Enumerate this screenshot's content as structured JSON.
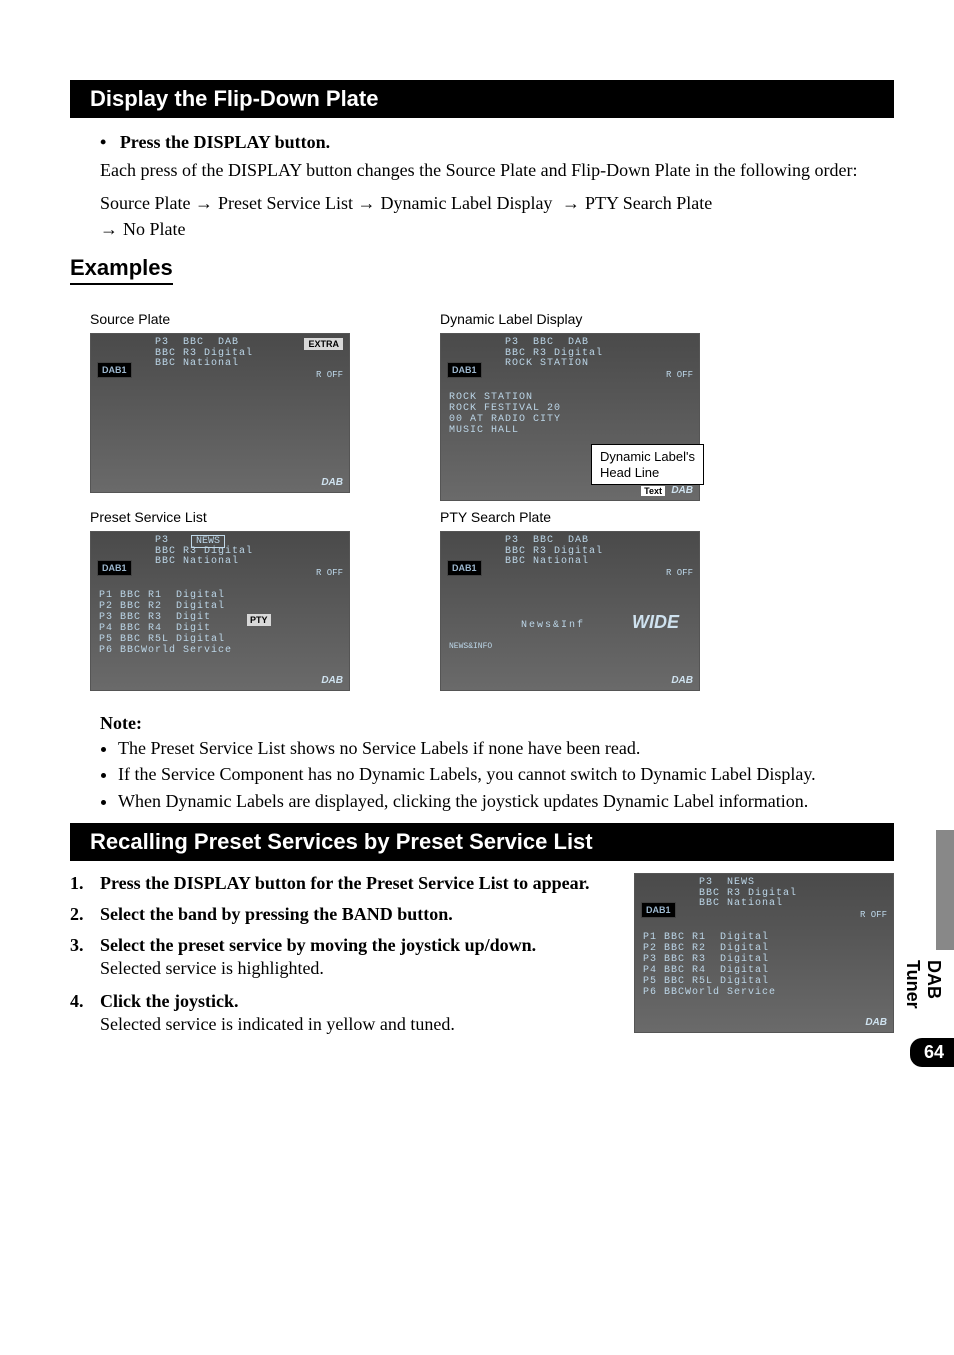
{
  "side_tab": "DAB Tuner",
  "page_number": "64",
  "sec1": {
    "title": "Display the Flip-Down Plate",
    "bullet_title": "Press the DISPLAY button.",
    "bullet_body": "Each press of the DISPLAY button changes the Source Plate and Flip-Down Plate in the following order:",
    "flow": {
      "a": "Source Plate",
      "b": "Preset Service List",
      "c": "Dynamic Label Display",
      "d": "PTY Search Plate",
      "e": "No Plate"
    }
  },
  "examples": {
    "heading": "Examples",
    "source_plate": {
      "caption": "Source Plate",
      "header": "P3  BBC  DAB\nBBC R3 Digital\nBBC National",
      "extra": "EXTRA",
      "dab1": "DAB1",
      "off": "R  OFF",
      "dab": "DAB"
    },
    "preset_list": {
      "caption": "Preset Service List",
      "header": "P3\nBBC R3 Digital\nBBC National",
      "news_box": "NEWS",
      "dab1": "DAB1",
      "off": "R  OFF",
      "list": "P1 BBC R1  Digital\nP2 BBC R2  Digital\nP3 BBC R3  Digit\nP4 BBC R4  Digit\nP5 BBC R5L Digital\nP6 BBCWorld Service",
      "pty": "PTY",
      "dab": "DAB"
    },
    "dynamic_label": {
      "caption": "Dynamic Label Display",
      "header": "P3  BBC  DAB\nBBC R3 Digital\nROCK STATION",
      "dab1": "DAB1",
      "off": "R  OFF",
      "body": "ROCK STATION\nROCK FESTIVAL 20\n00 AT RADIO CITY\nMUSIC HALL",
      "callout": "Dynamic Label's\nHead Line",
      "text_badge": "Text",
      "dab": "DAB"
    },
    "pty_search": {
      "caption": "PTY Search Plate",
      "header": "P3  BBC  DAB\nBBC R3 Digital\nBBC National",
      "dab1": "DAB1",
      "off": "R  OFF",
      "body": "News&Inf",
      "wide": "WIDE",
      "icon_label": "NEWS&INFO",
      "dab": "DAB"
    }
  },
  "note": {
    "title": "Note:",
    "n1": "The Preset Service List shows no Service Labels if none have been read.",
    "n2": "If the Service Component has no Dynamic Labels, you cannot switch to Dynamic Label Display.",
    "n3": "When Dynamic Labels are displayed, clicking the joystick updates Dynamic Label information."
  },
  "sec2": {
    "title": "Recalling Preset Services by Preset Service List",
    "steps": {
      "s1_t": "Press the DISPLAY button for the Preset Service List to appear.",
      "s2_t": "Select the band by pressing the BAND button.",
      "s3_t": "Select the preset service by moving the joystick up/down.",
      "s3_b": "Selected service is highlighted.",
      "s4_t": "Click the joystick.",
      "s4_b": "Selected service is indicated in yellow and tuned."
    },
    "shot": {
      "header": "P3  NEWS\nBBC R3 Digital\nBBC National",
      "dab1": "DAB1",
      "off": "R  OFF",
      "list": "P1 BBC R1  Digital\nP2 BBC R2  Digital\nP3 BBC R3  Digital\nP4 BBC R4  Digital\nP5 BBC R5L Digital\nP6 BBCWorld Service",
      "dab": "DAB"
    }
  }
}
